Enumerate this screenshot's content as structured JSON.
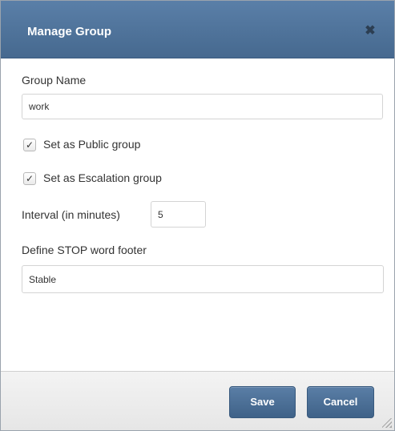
{
  "dialog": {
    "title": "Manage Group",
    "close_icon": "close-icon",
    "group_name": {
      "label": "Group Name",
      "value": "work"
    },
    "public_group": {
      "label": "Set as Public group",
      "checked": true
    },
    "escalation_group": {
      "label": "Set as Escalation group",
      "checked": true
    },
    "interval": {
      "label": "Interval (in minutes)",
      "value": "5"
    },
    "stop_word_footer": {
      "label": "Define STOP word footer",
      "value": "Stable"
    },
    "buttons": {
      "save": "Save",
      "cancel": "Cancel"
    }
  },
  "colors": {
    "header": "#4f7399",
    "button": "#4b6f96",
    "footer": "#ececec"
  }
}
